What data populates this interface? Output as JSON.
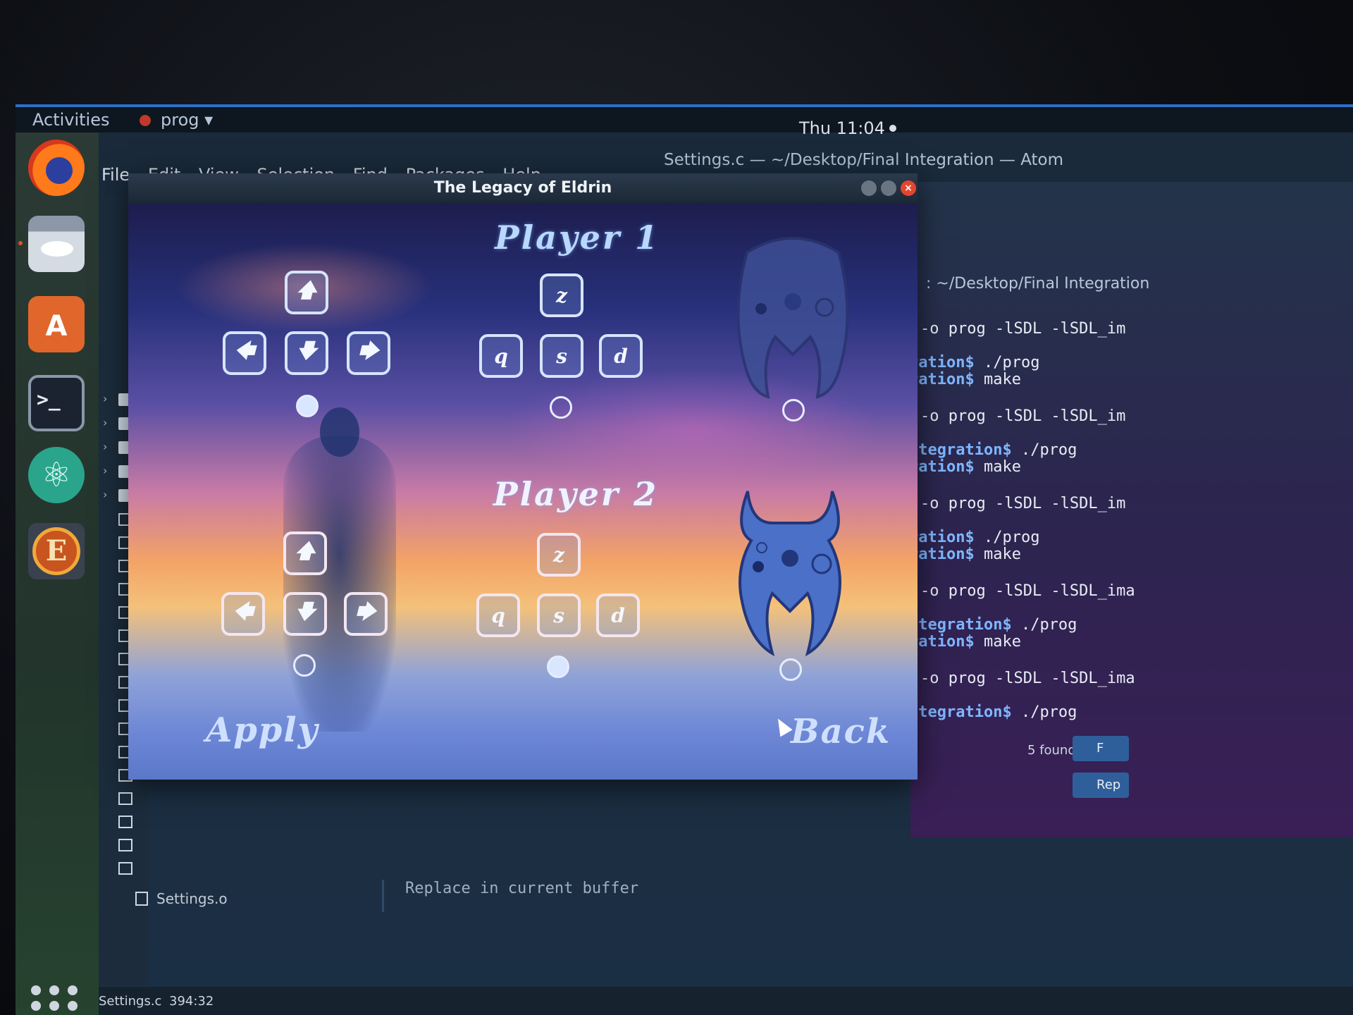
{
  "topbar": {
    "activities": "Activities",
    "app_menu": "prog",
    "app_menu_arrow": "▾",
    "clock": "Thu 11:04"
  },
  "dock": {
    "items": [
      "firefox-icon",
      "files-icon",
      "software-icon",
      "terminal-icon",
      "atom-icon",
      "eldrin-icon",
      "show-apps-icon"
    ],
    "terminal_glyph": ">_",
    "store_glyph": "A",
    "atom_glyph": "⚛",
    "eldrin_glyph": "E"
  },
  "atom": {
    "title": "Settings.c — ~/Desktop/Final Integration — Atom",
    "menu": [
      "File",
      "Edit",
      "View",
      "Selection",
      "Find",
      "Packages",
      "Help"
    ],
    "tree_last_file": "Settings.o",
    "find_placeholder": "Replace in current buffer",
    "found": "5 found",
    "status_file": "Settings.c",
    "status_pos": "394:32"
  },
  "terminal": {
    "path": ": ~/Desktop/Final Integration",
    "lines": [
      {
        "prompt": "",
        "cmd": " -o prog -lSDL -lSDL_im"
      },
      {
        "prompt": "ration$",
        "cmd": " ./prog"
      },
      {
        "prompt": "ration$",
        "cmd": " make"
      },
      {
        "prompt": "",
        "cmd": " -o prog -lSDL -lSDL_im"
      },
      {
        "prompt": "ntegration$",
        "cmd": " ./prog"
      },
      {
        "prompt": "ration$",
        "cmd": " make"
      },
      {
        "prompt": "",
        "cmd": " -o prog -lSDL -lSDL_im"
      },
      {
        "prompt": "ration$",
        "cmd": " ./prog"
      },
      {
        "prompt": "ration$",
        "cmd": " make"
      },
      {
        "prompt": "",
        "cmd": " -o prog -lSDL -lSDL_ima"
      },
      {
        "prompt": "ntegration$",
        "cmd": " ./prog"
      },
      {
        "prompt": "ration$",
        "cmd": " make"
      },
      {
        "prompt": "",
        "cmd": " -o prog -lSDL -lSDL_ima"
      },
      {
        "prompt": "ntegration$",
        "cmd": " ./prog"
      }
    ]
  },
  "game": {
    "title": "The Legacy of Eldrin",
    "close_glyph": "×",
    "player1": {
      "title": "Player 1",
      "arrow_keys": {
        "up": "🡅",
        "left": "🡄",
        "down": "🡇",
        "right": "🡆"
      },
      "letter_keys": {
        "up": "z",
        "left": "q",
        "down": "s",
        "right": "d"
      },
      "selected_scheme": "arrows"
    },
    "player2": {
      "title": "Player 2",
      "arrow_keys": {
        "up": "🡅",
        "left": "🡄",
        "down": "🡇",
        "right": "🡆"
      },
      "letter_keys": {
        "up": "z",
        "left": "q",
        "down": "s",
        "right": "d"
      },
      "selected_scheme": "letters"
    },
    "apply": "Apply",
    "back": "Back"
  },
  "colors": {
    "accent": "#2a70c8",
    "close": "#e2462f",
    "key_border": "#d6e4ff"
  }
}
